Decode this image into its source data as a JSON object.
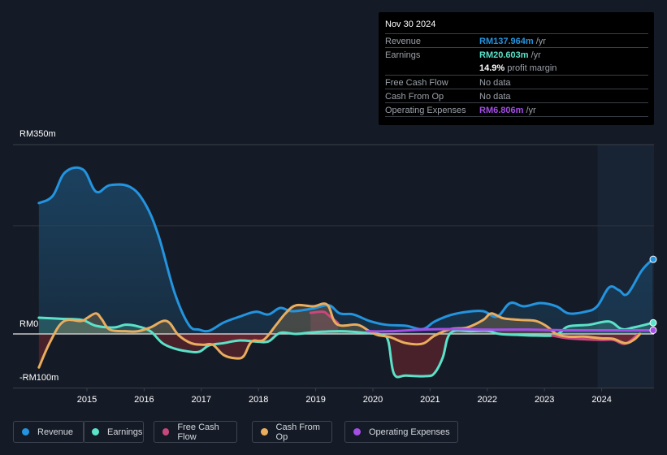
{
  "tooltip": {
    "date": "Nov 30 2024",
    "rows": [
      {
        "label": "Revenue",
        "value": "RM137.964m",
        "suffix": " /yr",
        "color": "#2394df"
      },
      {
        "label": "Earnings",
        "value": "RM20.603m",
        "suffix": " /yr",
        "color": "#5be2c9"
      },
      {
        "label": "",
        "value": "14.9%",
        "suffix": " profit margin",
        "color": "#ffffff"
      },
      {
        "label": "Free Cash Flow",
        "value": "",
        "suffix": "No data",
        "color": "#9aa0a8"
      },
      {
        "label": "Cash From Op",
        "value": "",
        "suffix": "No data",
        "color": "#9aa0a8"
      },
      {
        "label": "Operating Expenses",
        "value": "RM6.806m",
        "suffix": " /yr",
        "color": "#a44ee6"
      }
    ]
  },
  "legend": [
    {
      "label": "Revenue",
      "color": "#2394df"
    },
    {
      "label": "Earnings",
      "color": "#5be2c9"
    },
    {
      "label": "Free Cash Flow",
      "color": "#c9487c"
    },
    {
      "label": "Cash From Op",
      "color": "#e9ad5d"
    },
    {
      "label": "Operating Expenses",
      "color": "#a44ee6"
    }
  ],
  "chart_data": {
    "type": "line",
    "title": "",
    "xlabel": "",
    "ylabel": "",
    "y_unit": "RM m",
    "ylim": [
      -100,
      350
    ],
    "xlim": [
      2014.0,
      2024.92
    ],
    "y_ticks": [
      {
        "value": 350,
        "label": "RM350m"
      },
      {
        "value": 0,
        "label": "RM0"
      },
      {
        "value": -100,
        "label": "-RM100m"
      }
    ],
    "x_ticks": [
      "2015",
      "2016",
      "2017",
      "2018",
      "2019",
      "2020",
      "2021",
      "2022",
      "2023",
      "2024"
    ],
    "forecast_region_start": 2023.93,
    "grid": true,
    "series": [
      {
        "name": "Revenue",
        "color": "#2394df",
        "area": true,
        "points": [
          [
            2014.16,
            242
          ],
          [
            2014.4,
            255
          ],
          [
            2014.62,
            299
          ],
          [
            2014.93,
            304
          ],
          [
            2015.16,
            263
          ],
          [
            2015.4,
            275
          ],
          [
            2015.75,
            272
          ],
          [
            2016.01,
            242
          ],
          [
            2016.25,
            182
          ],
          [
            2016.53,
            77
          ],
          [
            2016.78,
            17
          ],
          [
            2016.96,
            8
          ],
          [
            2017.14,
            6
          ],
          [
            2017.39,
            21
          ],
          [
            2017.67,
            32
          ],
          [
            2017.95,
            41
          ],
          [
            2018.17,
            36
          ],
          [
            2018.38,
            48
          ],
          [
            2018.59,
            42
          ],
          [
            2018.95,
            47
          ],
          [
            2019.23,
            53
          ],
          [
            2019.42,
            38
          ],
          [
            2019.66,
            36
          ],
          [
            2019.94,
            24
          ],
          [
            2020.23,
            17
          ],
          [
            2020.58,
            15
          ],
          [
            2020.87,
            9
          ],
          [
            2021.08,
            23
          ],
          [
            2021.36,
            35
          ],
          [
            2021.65,
            41
          ],
          [
            2021.93,
            42
          ],
          [
            2022.17,
            32
          ],
          [
            2022.4,
            57
          ],
          [
            2022.64,
            51
          ],
          [
            2022.93,
            57
          ],
          [
            2023.21,
            51
          ],
          [
            2023.42,
            38
          ],
          [
            2023.71,
            41
          ],
          [
            2023.92,
            51
          ],
          [
            2024.13,
            86
          ],
          [
            2024.3,
            81
          ],
          [
            2024.45,
            74
          ],
          [
            2024.7,
            117
          ],
          [
            2024.89,
            137.964
          ]
        ]
      },
      {
        "name": "Earnings",
        "color": "#5be2c9",
        "area": true,
        "points": [
          [
            2014.16,
            30
          ],
          [
            2014.55,
            28
          ],
          [
            2014.91,
            26
          ],
          [
            2015.16,
            15
          ],
          [
            2015.47,
            12
          ],
          [
            2015.68,
            17
          ],
          [
            2015.89,
            14
          ],
          [
            2016.11,
            5
          ],
          [
            2016.32,
            -17
          ],
          [
            2016.53,
            -27
          ],
          [
            2016.75,
            -32
          ],
          [
            2016.96,
            -33
          ],
          [
            2017.14,
            -21
          ],
          [
            2017.39,
            -17
          ],
          [
            2017.67,
            -12
          ],
          [
            2017.95,
            -14
          ],
          [
            2018.17,
            -14
          ],
          [
            2018.38,
            2
          ],
          [
            2018.66,
            0
          ],
          [
            2018.95,
            3
          ],
          [
            2019.44,
            5
          ],
          [
            2019.87,
            2
          ],
          [
            2020.16,
            -2
          ],
          [
            2020.27,
            -14
          ],
          [
            2020.37,
            -74
          ],
          [
            2020.58,
            -77
          ],
          [
            2020.94,
            -78
          ],
          [
            2021.08,
            -72
          ],
          [
            2021.22,
            -44
          ],
          [
            2021.36,
            2
          ],
          [
            2021.72,
            5
          ],
          [
            2022.0,
            6
          ],
          [
            2022.21,
            0
          ],
          [
            2022.57,
            -2
          ],
          [
            2022.85,
            -3
          ],
          [
            2023.14,
            -3
          ],
          [
            2023.28,
            3
          ],
          [
            2023.42,
            14
          ],
          [
            2023.78,
            17
          ],
          [
            2024.13,
            23
          ],
          [
            2024.35,
            9
          ],
          [
            2024.56,
            12
          ],
          [
            2024.89,
            20.603
          ]
        ]
      },
      {
        "name": "Free Cash Flow",
        "color": "#c9487c",
        "area": true,
        "segments": [
          [
            [
              2018.91,
              39
            ],
            [
              2019.13,
              41
            ],
            [
              2019.22,
              35
            ],
            [
              2019.39,
              20
            ]
          ],
          [
            [
              2023.14,
              -3
            ],
            [
              2023.42,
              -8
            ],
            [
              2023.99,
              -11
            ],
            [
              2024.2,
              -11
            ],
            [
              2024.41,
              -18
            ],
            [
              2024.62,
              -2
            ]
          ]
        ]
      },
      {
        "name": "Cash From Op",
        "color": "#e9ad5d",
        "area": true,
        "points": [
          [
            2014.16,
            -62
          ],
          [
            2014.36,
            -14
          ],
          [
            2014.59,
            23
          ],
          [
            2014.9,
            24
          ],
          [
            2015.01,
            30
          ],
          [
            2015.16,
            38
          ],
          [
            2015.26,
            27
          ],
          [
            2015.4,
            8
          ],
          [
            2015.68,
            5
          ],
          [
            2015.89,
            5
          ],
          [
            2016.11,
            12
          ],
          [
            2016.39,
            24
          ],
          [
            2016.6,
            -2
          ],
          [
            2016.82,
            -17
          ],
          [
            2017.03,
            -20
          ],
          [
            2017.2,
            -20
          ],
          [
            2017.39,
            -39
          ],
          [
            2017.6,
            -45
          ],
          [
            2017.74,
            -41
          ],
          [
            2017.88,
            -14
          ],
          [
            2018.09,
            -11
          ],
          [
            2018.31,
            17
          ],
          [
            2018.48,
            39
          ],
          [
            2018.66,
            53
          ],
          [
            2018.95,
            51
          ],
          [
            2019.2,
            54
          ],
          [
            2019.37,
            18
          ],
          [
            2019.73,
            17
          ],
          [
            2019.94,
            5
          ],
          [
            2020.08,
            -2
          ],
          [
            2020.3,
            -6
          ],
          [
            2020.58,
            -17
          ],
          [
            2020.87,
            -18
          ],
          [
            2021.08,
            -3
          ],
          [
            2021.36,
            9
          ],
          [
            2021.65,
            12
          ],
          [
            2021.93,
            26
          ],
          [
            2022.07,
            38
          ],
          [
            2022.28,
            29
          ],
          [
            2022.57,
            26
          ],
          [
            2022.85,
            24
          ],
          [
            2023.04,
            14
          ],
          [
            2023.21,
            0
          ],
          [
            2023.42,
            -5
          ],
          [
            2023.71,
            -5
          ],
          [
            2023.99,
            -8
          ],
          [
            2024.2,
            -9
          ],
          [
            2024.41,
            -17
          ],
          [
            2024.56,
            -11
          ],
          [
            2024.67,
            0
          ]
        ]
      },
      {
        "name": "Operating Expenses",
        "color": "#a44ee6",
        "area": false,
        "points": [
          [
            2019.9,
            5
          ],
          [
            2020.3,
            5
          ],
          [
            2020.87,
            8
          ],
          [
            2021.43,
            9
          ],
          [
            2022.0,
            8
          ],
          [
            2022.71,
            8
          ],
          [
            2023.42,
            6.8
          ],
          [
            2024.13,
            6.8
          ],
          [
            2024.89,
            6.806
          ]
        ]
      }
    ]
  }
}
